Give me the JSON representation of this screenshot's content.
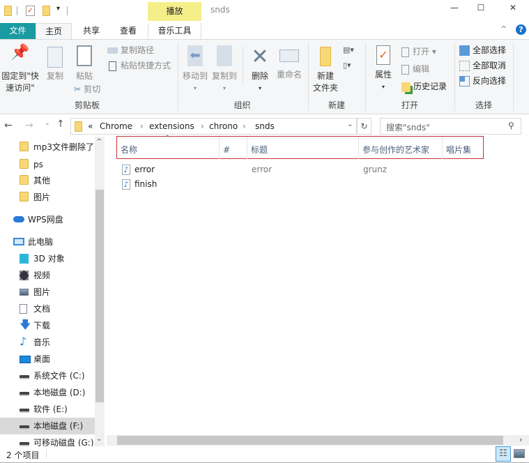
{
  "title_bar": {
    "window_title": "snds",
    "contextual_tab_group": "播放",
    "minimize": "—",
    "maximize": "☐",
    "close": "✕"
  },
  "tabs": [
    {
      "label": "文件"
    },
    {
      "label": "主页"
    },
    {
      "label": "共享"
    },
    {
      "label": "查看"
    },
    {
      "label": "音乐工具"
    }
  ],
  "ribbon": {
    "clipboard": {
      "pin": "固定到\"快速访问\"",
      "pin_l1": "固定到\"快",
      "pin_l2": "速访问\"",
      "copy": "复制",
      "paste": "粘贴",
      "copy_path": "复制路径",
      "paste_shortcut": "粘贴快捷方式",
      "cut": "剪切",
      "group": "剪贴板"
    },
    "organize": {
      "move_to": "移动到",
      "copy_to": "复制到",
      "delete": "删除",
      "rename": "重命名",
      "group": "组织"
    },
    "new": {
      "new_folder_l1": "新建",
      "new_folder_l2": "文件夹",
      "group": "新建"
    },
    "open": {
      "properties": "属性",
      "open": "打开",
      "edit": "编辑",
      "history": "历史记录",
      "group": "打开"
    },
    "select": {
      "select_all": "全部选择",
      "select_none": "全部取消",
      "invert": "反向选择",
      "group": "选择"
    }
  },
  "address": {
    "prefix": "«",
    "crumbs": [
      "Chrome",
      "extensions",
      "chrono",
      "snds"
    ],
    "search_placeholder": "搜索\"snds\""
  },
  "nav": [
    {
      "label": "mp3文件删除了",
      "icon": "folder-icon"
    },
    {
      "label": "ps",
      "icon": "folder-icon"
    },
    {
      "label": "其他",
      "icon": "folder-icon"
    },
    {
      "label": "图片",
      "icon": "folder-icon"
    },
    {
      "label": "WPS网盘",
      "icon": "cloud-icon"
    },
    {
      "label": "此电脑",
      "icon": "computer-icon"
    },
    {
      "label": "3D 对象",
      "icon": "3d-objects-icon"
    },
    {
      "label": "视频",
      "icon": "video-icon"
    },
    {
      "label": "图片",
      "icon": "pictures-icon"
    },
    {
      "label": "文档",
      "icon": "documents-icon"
    },
    {
      "label": "下载",
      "icon": "download-icon"
    },
    {
      "label": "音乐",
      "icon": "music-icon"
    },
    {
      "label": "桌面",
      "icon": "desktop-icon"
    },
    {
      "label": "系统文件 (C:)",
      "icon": "drive-icon"
    },
    {
      "label": "本地磁盘 (D:)",
      "icon": "drive-icon"
    },
    {
      "label": "软件 (E:)",
      "icon": "drive-icon"
    },
    {
      "label": "本地磁盘 (F:)",
      "icon": "drive-icon",
      "selected": true
    },
    {
      "label": "可移动磁盘 (G:)",
      "icon": "drive-icon"
    }
  ],
  "columns": [
    "名称",
    "#",
    "标题",
    "参与创作的艺术家",
    "唱片集"
  ],
  "files": [
    {
      "name": "error",
      "number": "",
      "title": "error",
      "artist": "grunz",
      "album": ""
    },
    {
      "name": "finish",
      "number": "",
      "title": "",
      "artist": "",
      "album": ""
    }
  ],
  "status": {
    "count": "2 个项目"
  },
  "colors": {
    "file_tab": "#1a9ba1",
    "contextual": "#f5ef8a",
    "highlight_box": "#c4323a",
    "selected_nav": "#d9d9d9"
  }
}
